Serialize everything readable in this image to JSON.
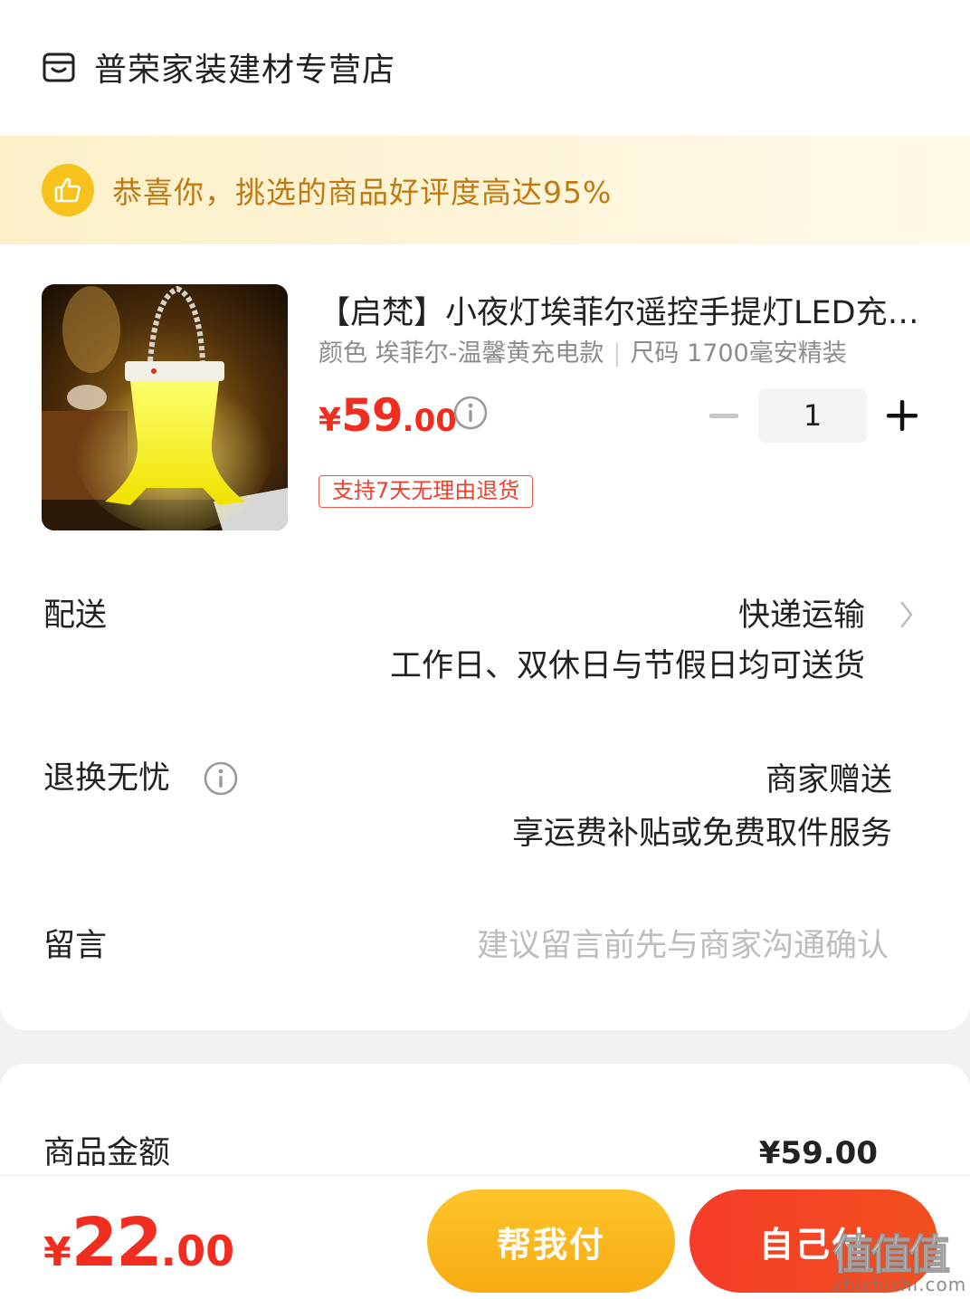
{
  "store": {
    "name": "普荣家装建材专营店",
    "icon": "store-icon"
  },
  "praise": {
    "text": "恭喜你，挑选的商品好评度高达95%",
    "icon": "thumbs-up-icon"
  },
  "product": {
    "title": "【启梵】小夜灯埃菲尔遥控手提灯LED充电款",
    "spec_color": "颜色 埃菲尔-温馨黄充电款",
    "spec_size": "尺码 1700毫安精装",
    "price_symbol": "¥",
    "price_int": "59",
    "price_dec": ".00",
    "quantity": "1",
    "return_tag": "支持7天无理由退货"
  },
  "delivery": {
    "label": "配送",
    "method": "快递运输",
    "note": "工作日、双休日与节假日均可送货"
  },
  "return_service": {
    "label": "退换无忧",
    "provider": "商家赠送",
    "desc": "享运费补贴或免费取件服务"
  },
  "message": {
    "label": "留言",
    "placeholder": "建议留言前先与商家沟通确认"
  },
  "summary": {
    "goods_amount_label": "商品金额",
    "goods_amount_value": "¥59.00"
  },
  "bottom": {
    "total_symbol": "¥",
    "total_int": "22",
    "total_dec": ".00",
    "help_pay": "帮我付",
    "self_pay": "自己付"
  },
  "watermark": {
    "logo": "值值值",
    "url": "zhizhizhi.com"
  },
  "colors": {
    "price_red": "#f02d1e",
    "banner_text": "#c07a12",
    "help_btn": "#f7ab12",
    "self_btn": "#f53c28"
  }
}
